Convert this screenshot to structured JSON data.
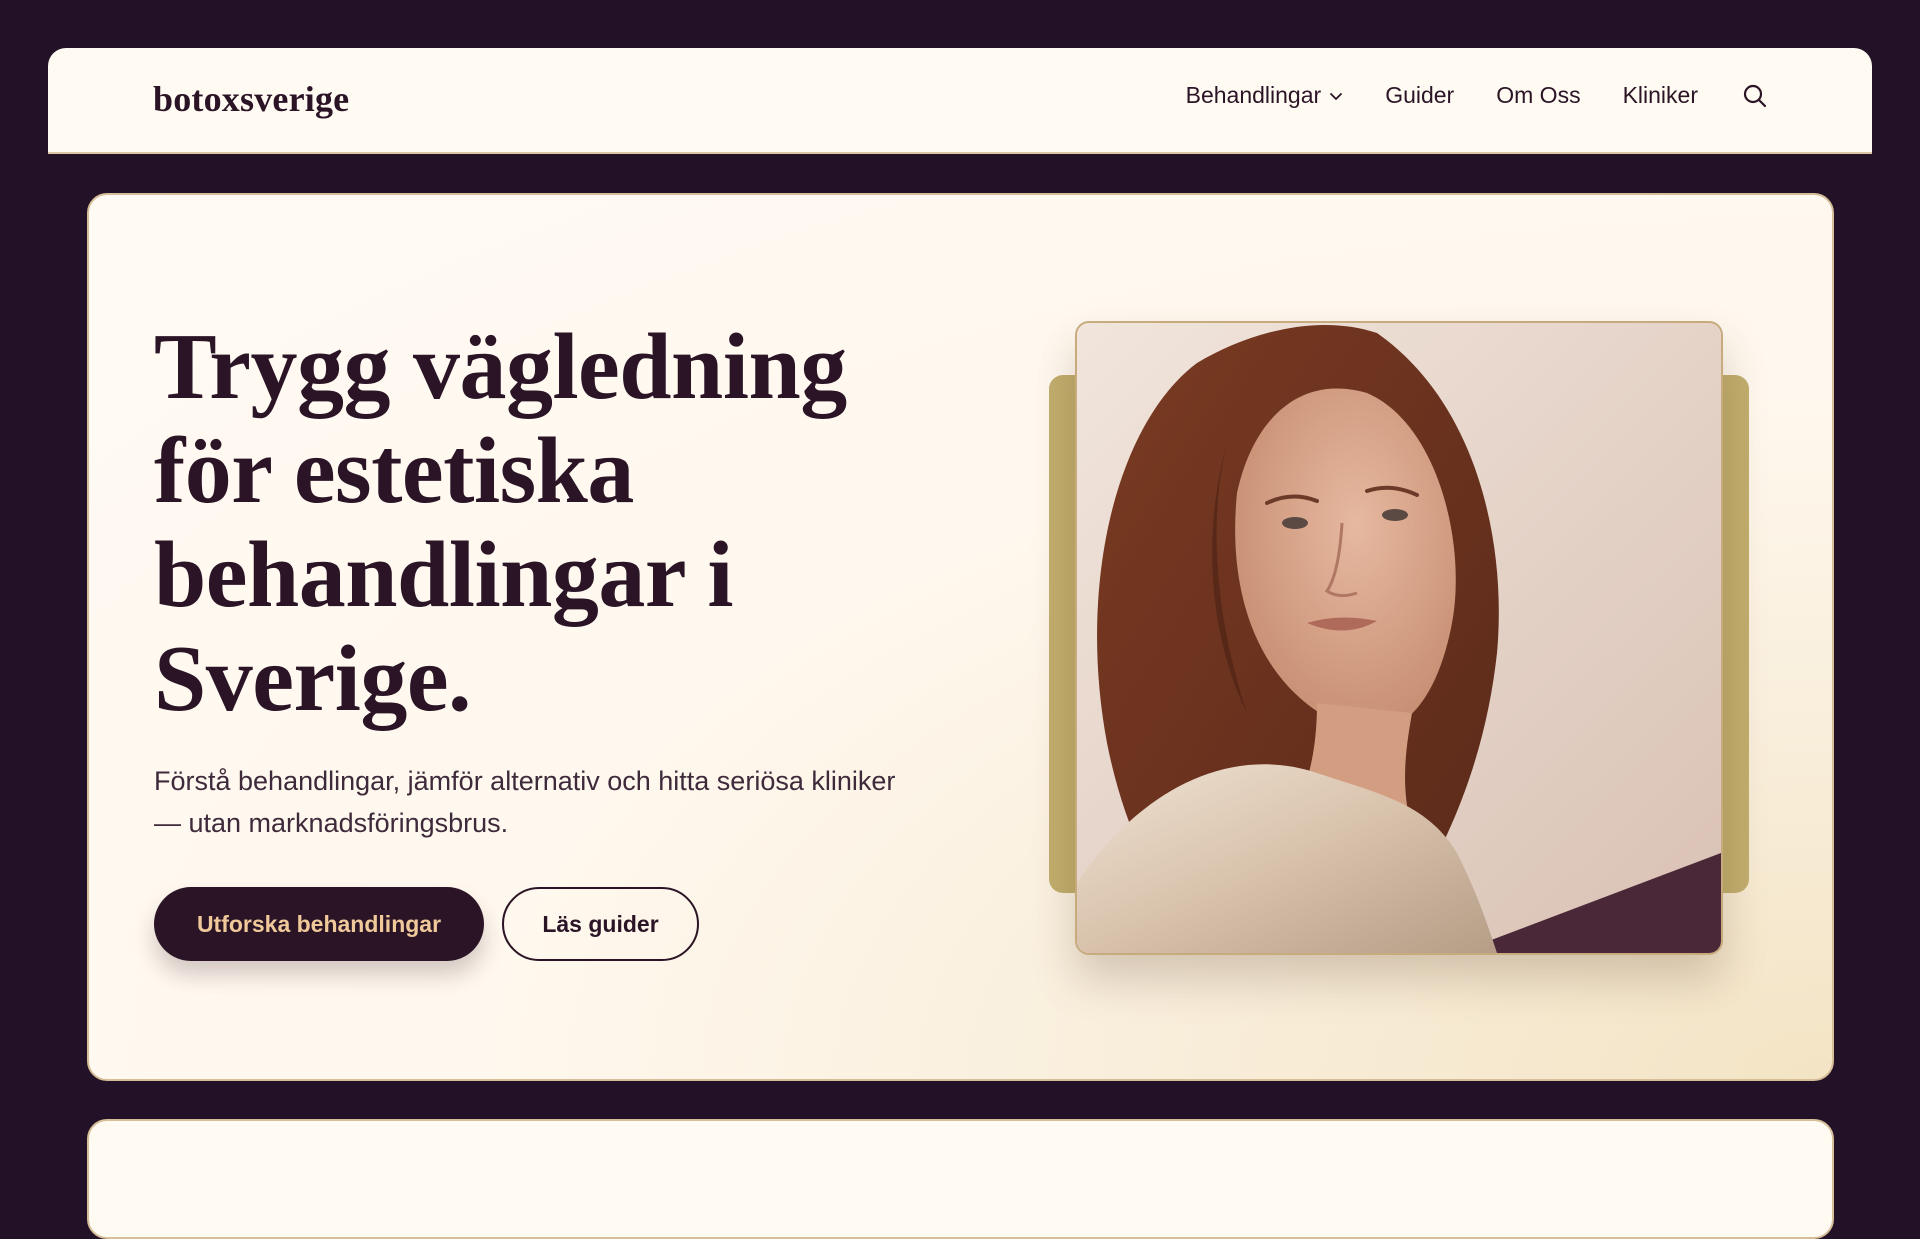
{
  "header": {
    "logo": "botoxsverige",
    "nav": [
      {
        "label": "Behandlingar",
        "has_dropdown": true
      },
      {
        "label": "Guider"
      },
      {
        "label": "Om Oss"
      },
      {
        "label": "Kliniker"
      }
    ],
    "search_icon": "search-icon"
  },
  "hero": {
    "title": "Trygg vägledning för estetiska behandlingar i Sverige.",
    "subtitle": "Förstå behandlingar, jämför alternativ och hitta seriösa kliniker — utan marknadsföringsbrus.",
    "primary_button": "Utforska behandlingar",
    "secondary_button": "Läs guider"
  },
  "colors": {
    "page_bg": "#231127",
    "surface": "#fffaf2",
    "ink": "#2a1426",
    "accent_gold": "#c2ae6d",
    "button_text": "#f0c99a"
  }
}
